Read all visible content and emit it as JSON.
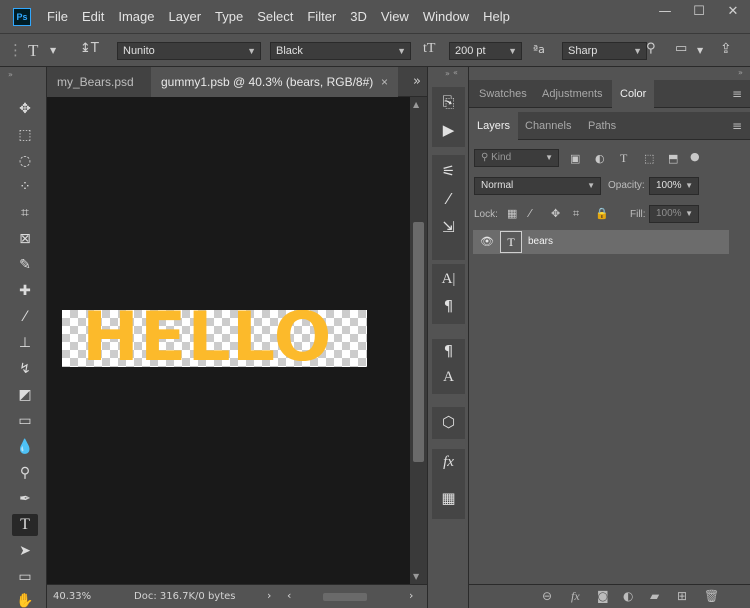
{
  "menubar": {
    "logo": "Ps",
    "items": [
      "File",
      "Edit",
      "Image",
      "Layer",
      "Type",
      "Select",
      "Filter",
      "3D",
      "View",
      "Window",
      "Help"
    ],
    "window_controls": [
      "—",
      "☐",
      "✕"
    ]
  },
  "options": {
    "tool_glyph": "T",
    "orient_glyph": "↨T",
    "font_family": "Nunito",
    "font_style": "Black",
    "size_glyph": "tT",
    "font_size": "200 pt",
    "aa_glyph": "ªa",
    "antialias": "Sharp"
  },
  "tabs": {
    "inactive": "my_Bears.psd",
    "active": "gummy1.psb @ 40.3% (bears, RGB/8#)",
    "close": "×",
    "overflow": "»"
  },
  "canvas": {
    "text": "HELLO",
    "text_color": "#fcba2b"
  },
  "status": {
    "zoom": "40.33%",
    "doc": "Doc: 316.7K/0 bytes"
  },
  "panels": {
    "top_tabs": [
      "Swatches",
      "Adjustments",
      "Color"
    ],
    "layer_tabs": [
      "Layers",
      "Channels",
      "Paths"
    ],
    "kind_placeholder": "Kind",
    "blend_mode": "Normal",
    "opacity_label": "Opacity:",
    "opacity": "100%",
    "lock_label": "Lock:",
    "fill_label": "Fill:",
    "fill": "100%",
    "layer": {
      "name": "bears",
      "thumb_glyph": "T"
    }
  }
}
